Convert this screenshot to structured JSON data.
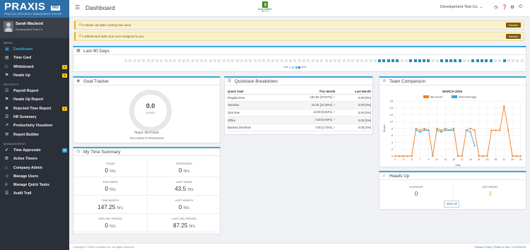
{
  "sidebar": {
    "logo": {
      "word": "PRAXIS",
      "suffix": "MS",
      "tagline": "PRACTICE EFFICIENCY MANAGEMENT SYSTEM"
    },
    "user": {
      "name": "Sarah Macleod",
      "company": "Development Test Co."
    },
    "sections": {
      "menu": "MENU",
      "reports": "REPORTS",
      "management": "MANAGEMENT"
    },
    "menu": [
      {
        "label": "Dashboard",
        "icon": "dashboard-icon",
        "active": true
      },
      {
        "label": "Time Card",
        "icon": "time-card-icon"
      },
      {
        "label": "Whiteboard",
        "icon": "whiteboard-icon",
        "badge": "2"
      },
      {
        "label": "Heads Up",
        "icon": "heads-up-icon",
        "badge": "3"
      }
    ],
    "reports": [
      {
        "label": "Payroll Report",
        "icon": "payroll-icon"
      },
      {
        "label": "Heads Up Report",
        "icon": "heads-up-report-icon"
      },
      {
        "label": "Rejected Time Report",
        "icon": "rejected-time-icon",
        "badge": "1"
      },
      {
        "label": "HR Summary",
        "icon": "hr-summary-icon"
      },
      {
        "label": "Productivity Visualizer",
        "icon": "productivity-icon"
      },
      {
        "label": "Report Builder",
        "icon": "report-builder-icon"
      }
    ],
    "management": [
      {
        "label": "Time Approvals",
        "icon": "check-icon",
        "badge": "0",
        "badge_color": "#3aa5d8"
      },
      {
        "label": "Active Timers",
        "icon": "timer-icon"
      },
      {
        "label": "Company Admin",
        "icon": "company-admin-icon"
      },
      {
        "label": "Manage Users",
        "icon": "users-icon"
      },
      {
        "label": "Manage Quick Tasks",
        "icon": "quick-tasks-icon"
      },
      {
        "label": "Audit Trail",
        "icon": "audit-trail-icon"
      }
    ]
  },
  "header": {
    "title": "Dashboard",
    "brand_line1": "DEVELOPMENT",
    "brand_line2": "TEST CO.",
    "company": "Development Test Co."
  },
  "alerts": [
    {
      "text": "3 Heads Up tasks coming due soon",
      "button": "Review"
    },
    {
      "text": "2 whiteboard tasks due soon assigned to you",
      "button": "Review"
    }
  ],
  "last90": {
    "title": "Last 90 Days",
    "legend_less": "Less",
    "legend_more": "More"
  },
  "goal": {
    "title": "Goal Tracker",
    "value": "0.0",
    "unit": "HOURS",
    "target": "Target: 36.5 hours",
    "caption": "THIS WEEK'S PROGRESS"
  },
  "summary": {
    "title": "My Time Summary",
    "cells": [
      {
        "label": "TODAY",
        "value": "0",
        "unit": "hrs"
      },
      {
        "label": "YESTERDAY",
        "value": "0",
        "unit": "hrs"
      },
      {
        "label": "THIS WEEK",
        "value": "0",
        "unit": "hrs"
      },
      {
        "label": "LAST WEEK",
        "value": "43.5",
        "unit": "hrs"
      },
      {
        "label": "THIS MONTH",
        "value": "147.25",
        "unit": "hrs"
      },
      {
        "label": "LAST MONTH",
        "value": "0",
        "unit": "hrs"
      },
      {
        "label": "THIS PAY PERIOD",
        "value": "0",
        "unit": "hrs"
      },
      {
        "label": "LAST PAY PERIOD",
        "value": "87.25",
        "unit": "hrs"
      }
    ]
  },
  "quick": {
    "title": "Quicktask Breakdown",
    "headers": [
      "Quick Task",
      "This Month",
      "Last Month"
    ],
    "rows": [
      {
        "task": "Regular time",
        "this_month": "104.50",
        "this_pct": "[70.97%]",
        "last_month": "0.00",
        "last_pct": "[0%]"
      },
      {
        "task": "Vacation",
        "this_month": "15.25",
        "this_pct": "[10.36%]",
        "last_month": "0.00",
        "last_pct": "[0%]"
      },
      {
        "task": "Sick time",
        "this_month": "13.00",
        "this_pct": "[8.83%]",
        "last_month": "0.00",
        "last_pct": "[0%]"
      },
      {
        "task": "Office",
        "this_month": "7.50",
        "this_pct": "[5.09%]",
        "last_month": "0.00",
        "last_pct": "[0%]"
      },
      {
        "task": "Banked Overtime",
        "this_month": "7.00",
        "this_pct": "[4.75%]",
        "last_month": "0.00",
        "last_pct": "[0%]"
      }
    ]
  },
  "team": {
    "title": "Team Comparison"
  },
  "headsup": {
    "title": "Heads Up",
    "overdue_label": "OVERDUE",
    "overdue": "0",
    "upcoming_label": "UPCOMING",
    "upcoming": "3",
    "view_all": "View All"
  },
  "footer": {
    "copyright": "Copyright © 2026 CloudAct Inc. All rights reserved.",
    "links": [
      "Privacy Policy",
      "Terms of Use",
      "v2.2026.03"
    ]
  },
  "colors": {
    "accent": "#3aa5d8",
    "sidebar": "#2b2f38",
    "my_hours": "#ef7d22",
    "team_average": "#3aa5d8"
  },
  "chart_data": {
    "type": "line",
    "title": "MARCH 2026",
    "xlabel": "Day",
    "ylabel": "Hours",
    "ylim": [
      0,
      16
    ],
    "y_ticks": [
      0,
      2,
      4,
      6,
      8,
      10,
      12,
      14,
      16
    ],
    "x": [
      1,
      2,
      3,
      4,
      5,
      6,
      7,
      8,
      9,
      10,
      11,
      12,
      13,
      14,
      15,
      16,
      17,
      18,
      19,
      20,
      21,
      22,
      23,
      24,
      25,
      26,
      27,
      28,
      29,
      30,
      31
    ],
    "x_ticks": [
      1,
      3,
      5,
      7,
      9,
      11,
      13,
      15,
      17,
      19,
      21,
      23,
      25,
      27,
      29,
      31
    ],
    "series": [
      {
        "name": "My Hours",
        "color": "#ef7d22",
        "values": [
          0,
          0,
          0,
          0,
          0,
          8,
          7.5,
          8,
          7.5,
          0,
          8,
          7.5,
          8,
          7.5,
          8,
          0,
          0,
          7.5,
          8,
          7.5,
          0,
          0,
          0,
          7.5,
          7.5,
          7.5,
          14.5,
          7.5,
          0,
          0,
          0
        ]
      },
      {
        "name": "Team Average",
        "color": "#3aa5d8",
        "values": [
          null,
          null,
          null,
          null,
          null,
          7.5,
          7,
          7.5,
          7.5,
          null,
          7.5,
          7,
          7.5,
          7.5,
          7.5,
          null,
          null,
          7.5,
          7,
          3,
          null,
          null,
          null,
          null,
          null,
          null,
          null,
          null,
          null,
          null,
          null
        ]
      }
    ]
  }
}
